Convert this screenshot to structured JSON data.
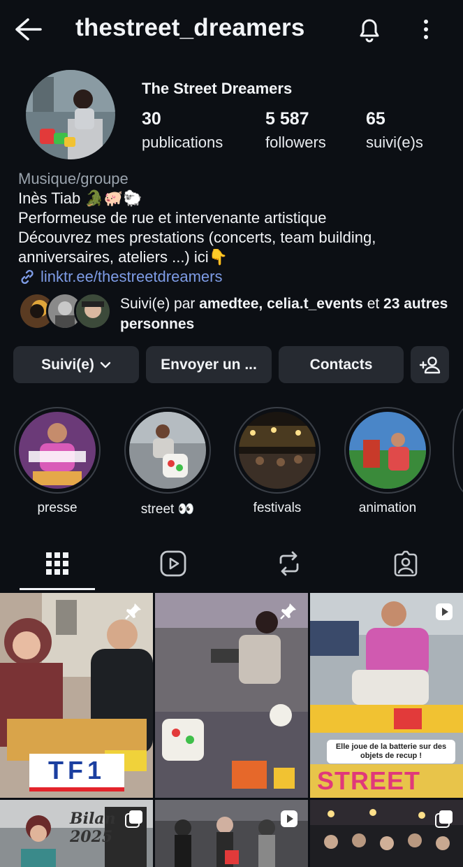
{
  "header": {
    "username": "thestreet_dreamers"
  },
  "profile": {
    "display_name": "The Street Dreamers",
    "stats": {
      "posts": {
        "value": "30",
        "label": "publications"
      },
      "followers": {
        "value": "5 587",
        "label": "followers"
      },
      "following": {
        "value": "65",
        "label": "suivi(e)s"
      }
    },
    "bio": {
      "category": "Musique/groupe",
      "name_line": "Inès Tiab 🐊🐖🐑",
      "line1": "Performeuse de rue et intervenante artistique",
      "line2": "Découvrez mes prestations (concerts, team building,",
      "line3": "anniversaires, ateliers ...) ici👇",
      "link": "linktr.ee/thestreetdreamers"
    },
    "followed_by": {
      "prefix": "Suivi(e) par ",
      "user1": "amedtee",
      "sep": ", ",
      "user2": "celia.t_events",
      "mid": " et ",
      "rest": "23 autres personnes"
    }
  },
  "actions": {
    "follow": "Suivi(e)",
    "message": "Envoyer un ...",
    "contacts": "Contacts"
  },
  "highlights": [
    {
      "label": "presse"
    },
    {
      "label": "street 👀"
    },
    {
      "label": "festivals"
    },
    {
      "label": "animation"
    }
  ],
  "grid": {
    "tf1_logo": "TF1",
    "caption3": "Elle joue de la batterie sur des objets de recup !",
    "street_sign": "STREET",
    "bilan_text": "Bilan 2025"
  },
  "colors": {
    "background": "#0c0f14",
    "button": "#262a31",
    "link": "#7e9ce6"
  }
}
